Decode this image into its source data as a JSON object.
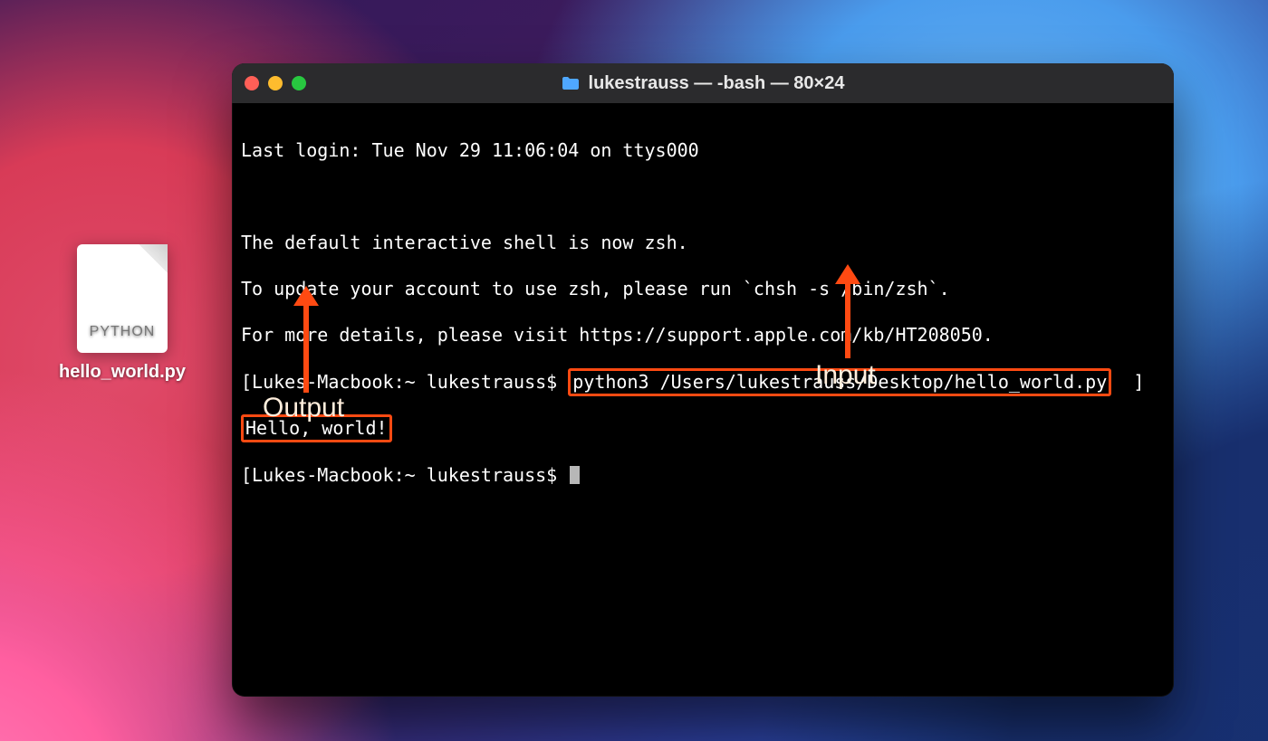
{
  "desktop": {
    "file_icon": {
      "type_label": "PYTHON",
      "filename": "hello_world.py"
    }
  },
  "terminal": {
    "title": "lukestrauss — -bash — 80×24",
    "lines": {
      "last_login": "Last login: Tue Nov 29 11:06:04 on ttys000",
      "zsh_note_1": "The default interactive shell is now zsh.",
      "zsh_note_2": "To update your account to use zsh, please run `chsh -s /bin/zsh`.",
      "zsh_note_3": "For more details, please visit https://support.apple.com/kb/HT208050.",
      "prompt_bracket_open": "[",
      "prompt": "Lukes-Macbook:~ lukestrauss$ ",
      "input_command": "python3 /Users/lukestrauss/Desktop/hello_world.py",
      "prompt_bracket_close": "  ]",
      "output": "Hello, world!",
      "prompt2_open": "[",
      "prompt2": "Lukes-Macbook:~ lukestrauss$ "
    }
  },
  "annotations": {
    "output_label": "Output",
    "input_label": "Input"
  },
  "colors": {
    "highlight": "#ff4a12",
    "text": "#ffffff",
    "label": "#ffeedc"
  }
}
